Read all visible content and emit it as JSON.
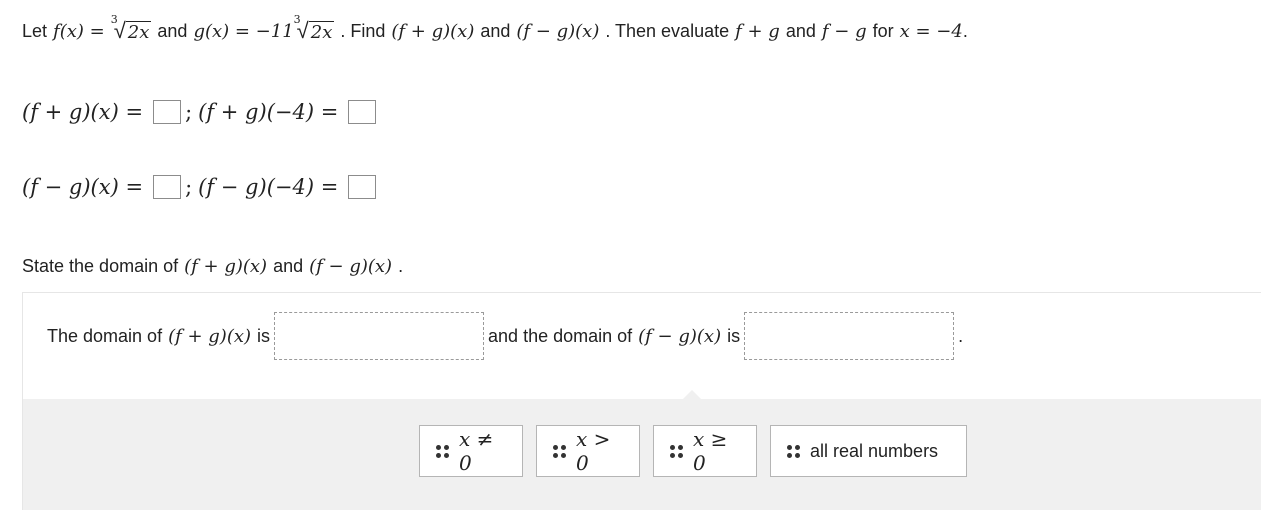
{
  "question": {
    "let": "Let",
    "f_def": "f(x) =",
    "f_index": "3",
    "f_radicand": "2x",
    "and1": "and",
    "g_def": "g(x) = −11",
    "g_index": "3",
    "g_radicand": "2x",
    "find": ". Find",
    "fpg": "(f + g)(x)",
    "and2": "and",
    "fmg": "(f − g)(x)",
    "then": ". Then evaluate",
    "fpg_short": "f + g",
    "and3": "and",
    "fmg_short": "f − g",
    "for": "for",
    "xval": "x = −4",
    "end": "."
  },
  "rows": [
    {
      "lhs": "(f + g)(x) =",
      "sep": ";",
      "eval": "(f + g)(−4) ="
    },
    {
      "lhs": "(f − g)(x) =",
      "sep": ";",
      "eval": "(f − g)(−4) ="
    }
  ],
  "domain_prompt": {
    "text": "State the domain of",
    "fpg": "(f + g)(x)",
    "and": "and",
    "fmg": "(f − g)(x)",
    "end": "."
  },
  "dnd": {
    "part1": "The domain of",
    "fpg": "(f + g)(x)",
    "is1": "is",
    "part2": "and the domain of",
    "fmg": "(f − g)(x)",
    "is2": "is",
    "end": "."
  },
  "tiles": [
    {
      "label": "x ≠ 0",
      "math": true
    },
    {
      "label": "x > 0",
      "math": true
    },
    {
      "label": "x ≥ 0",
      "math": true
    },
    {
      "label": "all real numbers",
      "math": false
    }
  ]
}
